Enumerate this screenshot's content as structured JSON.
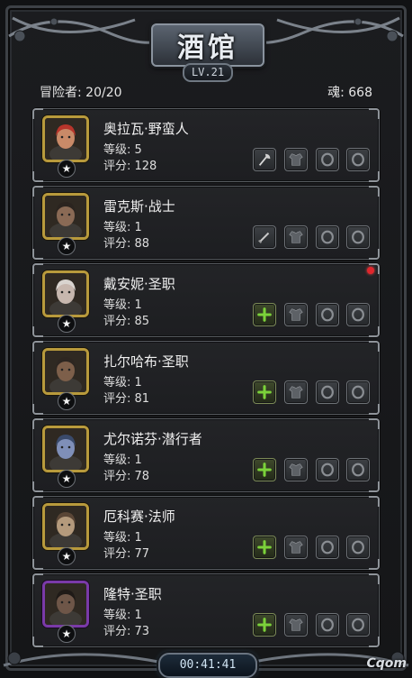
{
  "header": {
    "title": "酒馆",
    "level": "LV.21",
    "adventurers": "冒险者: 20/20",
    "souls": "魂: 668"
  },
  "heroes": [
    {
      "name": "奥拉瓦·野蛮人",
      "level": "等级: 5",
      "score": "评分: 128",
      "frame": "gold",
      "slot0": "axe-icon"
    },
    {
      "name": "雷克斯·战士",
      "level": "等级: 1",
      "score": "评分: 88",
      "frame": "gold",
      "slot0": "sword-icon"
    },
    {
      "name": "戴安妮·圣职",
      "level": "等级: 1",
      "score": "评分: 85",
      "frame": "gold",
      "slot0": "plus-icon"
    },
    {
      "name": "扎尔哈布·圣职",
      "level": "等级: 1",
      "score": "评分: 81",
      "frame": "gold",
      "slot0": "plus-icon"
    },
    {
      "name": "尤尔诺芬·潜行者",
      "level": "等级: 1",
      "score": "评分: 78",
      "frame": "gold",
      "slot0": "plus-icon"
    },
    {
      "name": "厄科赛·法师",
      "level": "等级: 1",
      "score": "评分: 77",
      "frame": "gold",
      "slot0": "plus-icon"
    },
    {
      "name": "隆特·圣职",
      "level": "等级: 1",
      "score": "评分: 73",
      "frame": "purple",
      "slot0": "plus-icon"
    }
  ],
  "slot_icons": [
    "armor-icon",
    "ring-icon",
    "ring-icon"
  ],
  "footer": {
    "timer": "00:41:41",
    "watermark": "Cqom"
  },
  "colors": {
    "gold_frame": "#b89a3c",
    "purple_frame": "#7a3aa8",
    "plus_green": "#7bd23a",
    "notification": "#e0262c"
  }
}
